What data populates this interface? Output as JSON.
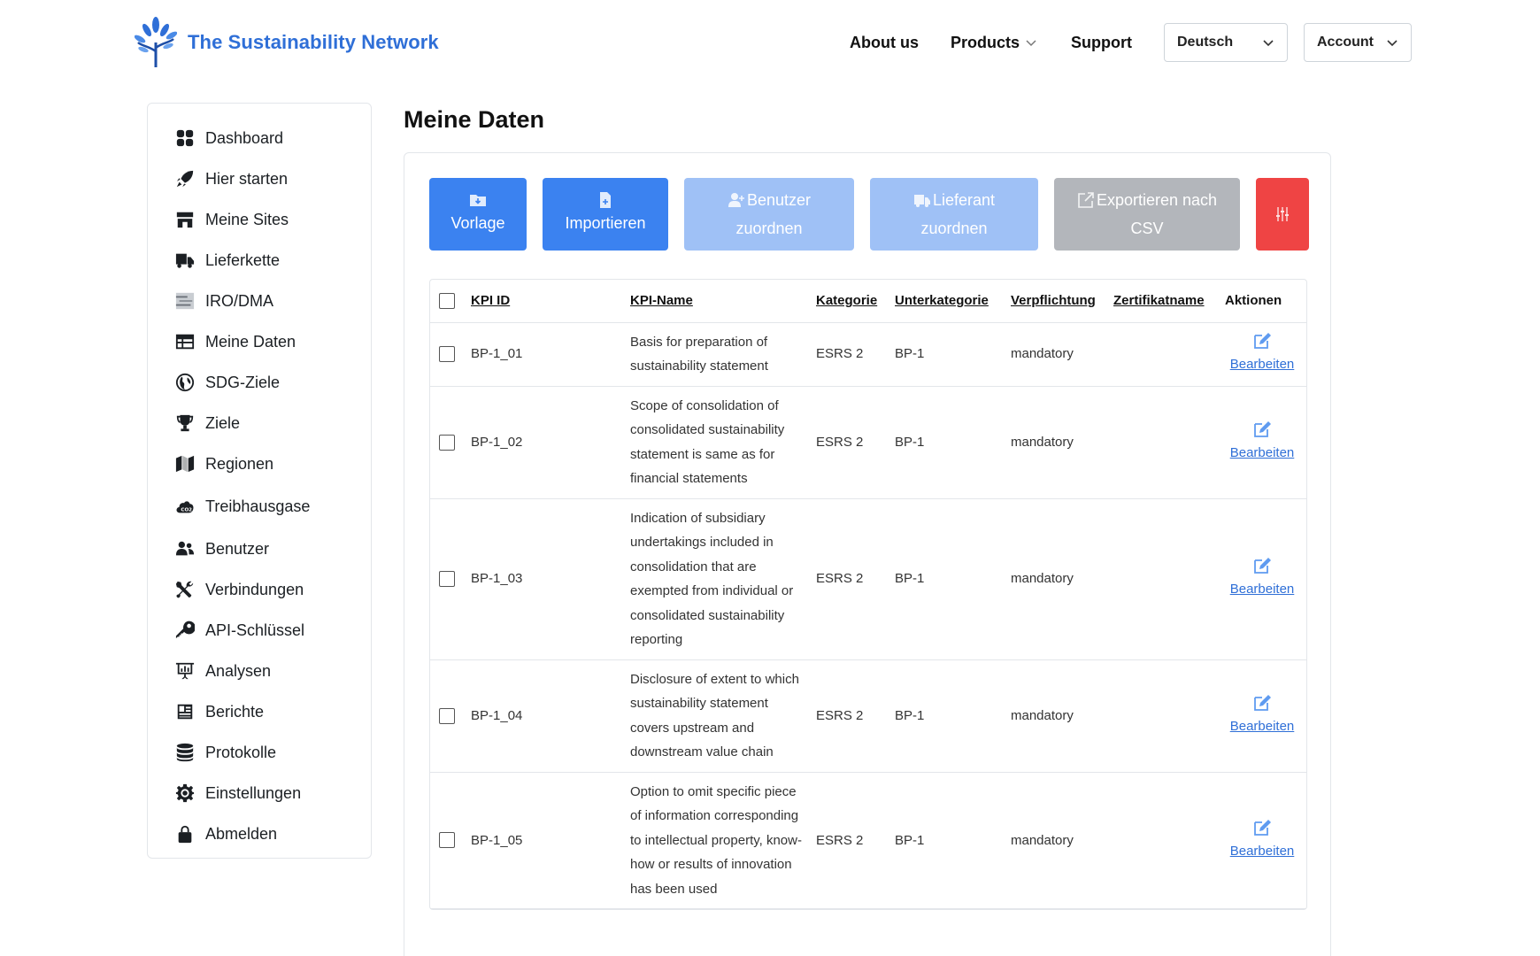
{
  "header": {
    "brand": "The Sustainability Network",
    "nav": {
      "about": "About us",
      "products": "Products",
      "support": "Support"
    },
    "language": "Deutsch",
    "account": "Account"
  },
  "sidebar": {
    "items": [
      {
        "label": "Dashboard",
        "icon": "dashboard-icon"
      },
      {
        "label": "Hier starten",
        "icon": "rocket-icon"
      },
      {
        "label": "Meine Sites",
        "icon": "store-icon"
      },
      {
        "label": "Lieferkette",
        "icon": "truck-icon"
      },
      {
        "label": "IRO/DMA",
        "icon": "matrix-icon"
      },
      {
        "label": "Meine Daten",
        "icon": "table-icon"
      },
      {
        "label": "SDG-Ziele",
        "icon": "globe-icon"
      },
      {
        "label": "Ziele",
        "icon": "trophy-icon"
      },
      {
        "label": "Regionen",
        "icon": "map-icon"
      },
      {
        "label": "Treibhausgase",
        "icon": "co2-cloud-icon"
      },
      {
        "label": "Benutzer",
        "icon": "users-icon"
      },
      {
        "label": "Verbindungen",
        "icon": "tools-icon"
      },
      {
        "label": "API-Schlüssel",
        "icon": "key-icon"
      },
      {
        "label": "Analysen",
        "icon": "presentation-chart-icon"
      },
      {
        "label": "Berichte",
        "icon": "newspaper-icon"
      },
      {
        "label": "Protokolle",
        "icon": "database-icon"
      },
      {
        "label": "Einstellungen",
        "icon": "gear-icon"
      },
      {
        "label": "Abmelden",
        "icon": "lock-icon"
      }
    ]
  },
  "main": {
    "title": "Meine Daten",
    "toolbar": {
      "template": "Vorlage",
      "import": "Importieren",
      "assign_user_1": "Benutzer",
      "assign_user_2": "zuordnen",
      "assign_supplier_1": "Lieferant",
      "assign_supplier_2": "zuordnen",
      "export_1": "Exportieren nach",
      "export_2": "CSV"
    },
    "table": {
      "headers": {
        "kpi_id": "KPI ID",
        "kpi_name": "KPI-Name",
        "category": "Kategorie",
        "subcategory": "Unterkategorie",
        "obligation": "Verpflichtung",
        "certificate": "Zertifikatname",
        "actions": "Aktionen"
      },
      "edit_label": "Bearbeiten",
      "rows": [
        {
          "id": "BP-1_01",
          "name": "Basis for preparation of sustainability statement",
          "category": "ESRS 2",
          "subcategory": "BP-1",
          "obligation": "mandatory",
          "certificate": ""
        },
        {
          "id": "BP-1_02",
          "name": "Scope of consolidation of consolidated sustainability statement is same as for financial statements",
          "category": "ESRS 2",
          "subcategory": "BP-1",
          "obligation": "mandatory",
          "certificate": ""
        },
        {
          "id": "BP-1_03",
          "name": "Indication of subsidiary undertakings included in consolidation that are exempted from individual or consolidated sustainability reporting",
          "category": "ESRS 2",
          "subcategory": "BP-1",
          "obligation": "mandatory",
          "certificate": ""
        },
        {
          "id": "BP-1_04",
          "name": "Disclosure of extent to which sustainability statement covers upstream and downstream value chain",
          "category": "ESRS 2",
          "subcategory": "BP-1",
          "obligation": "mandatory",
          "certificate": ""
        },
        {
          "id": "BP-1_05",
          "name": "Option to omit specific piece of information corresponding to intellectual property, know-how or results of innovation has been used",
          "category": "ESRS 2",
          "subcategory": "BP-1",
          "obligation": "mandatory",
          "certificate": ""
        }
      ]
    }
  },
  "colors": {
    "brand": "#2f6fd7",
    "primary_button": "#3b82f0",
    "faded_button": "#9fc1f6",
    "grey_button": "#b3b6bb",
    "danger_button": "#ef4444"
  }
}
